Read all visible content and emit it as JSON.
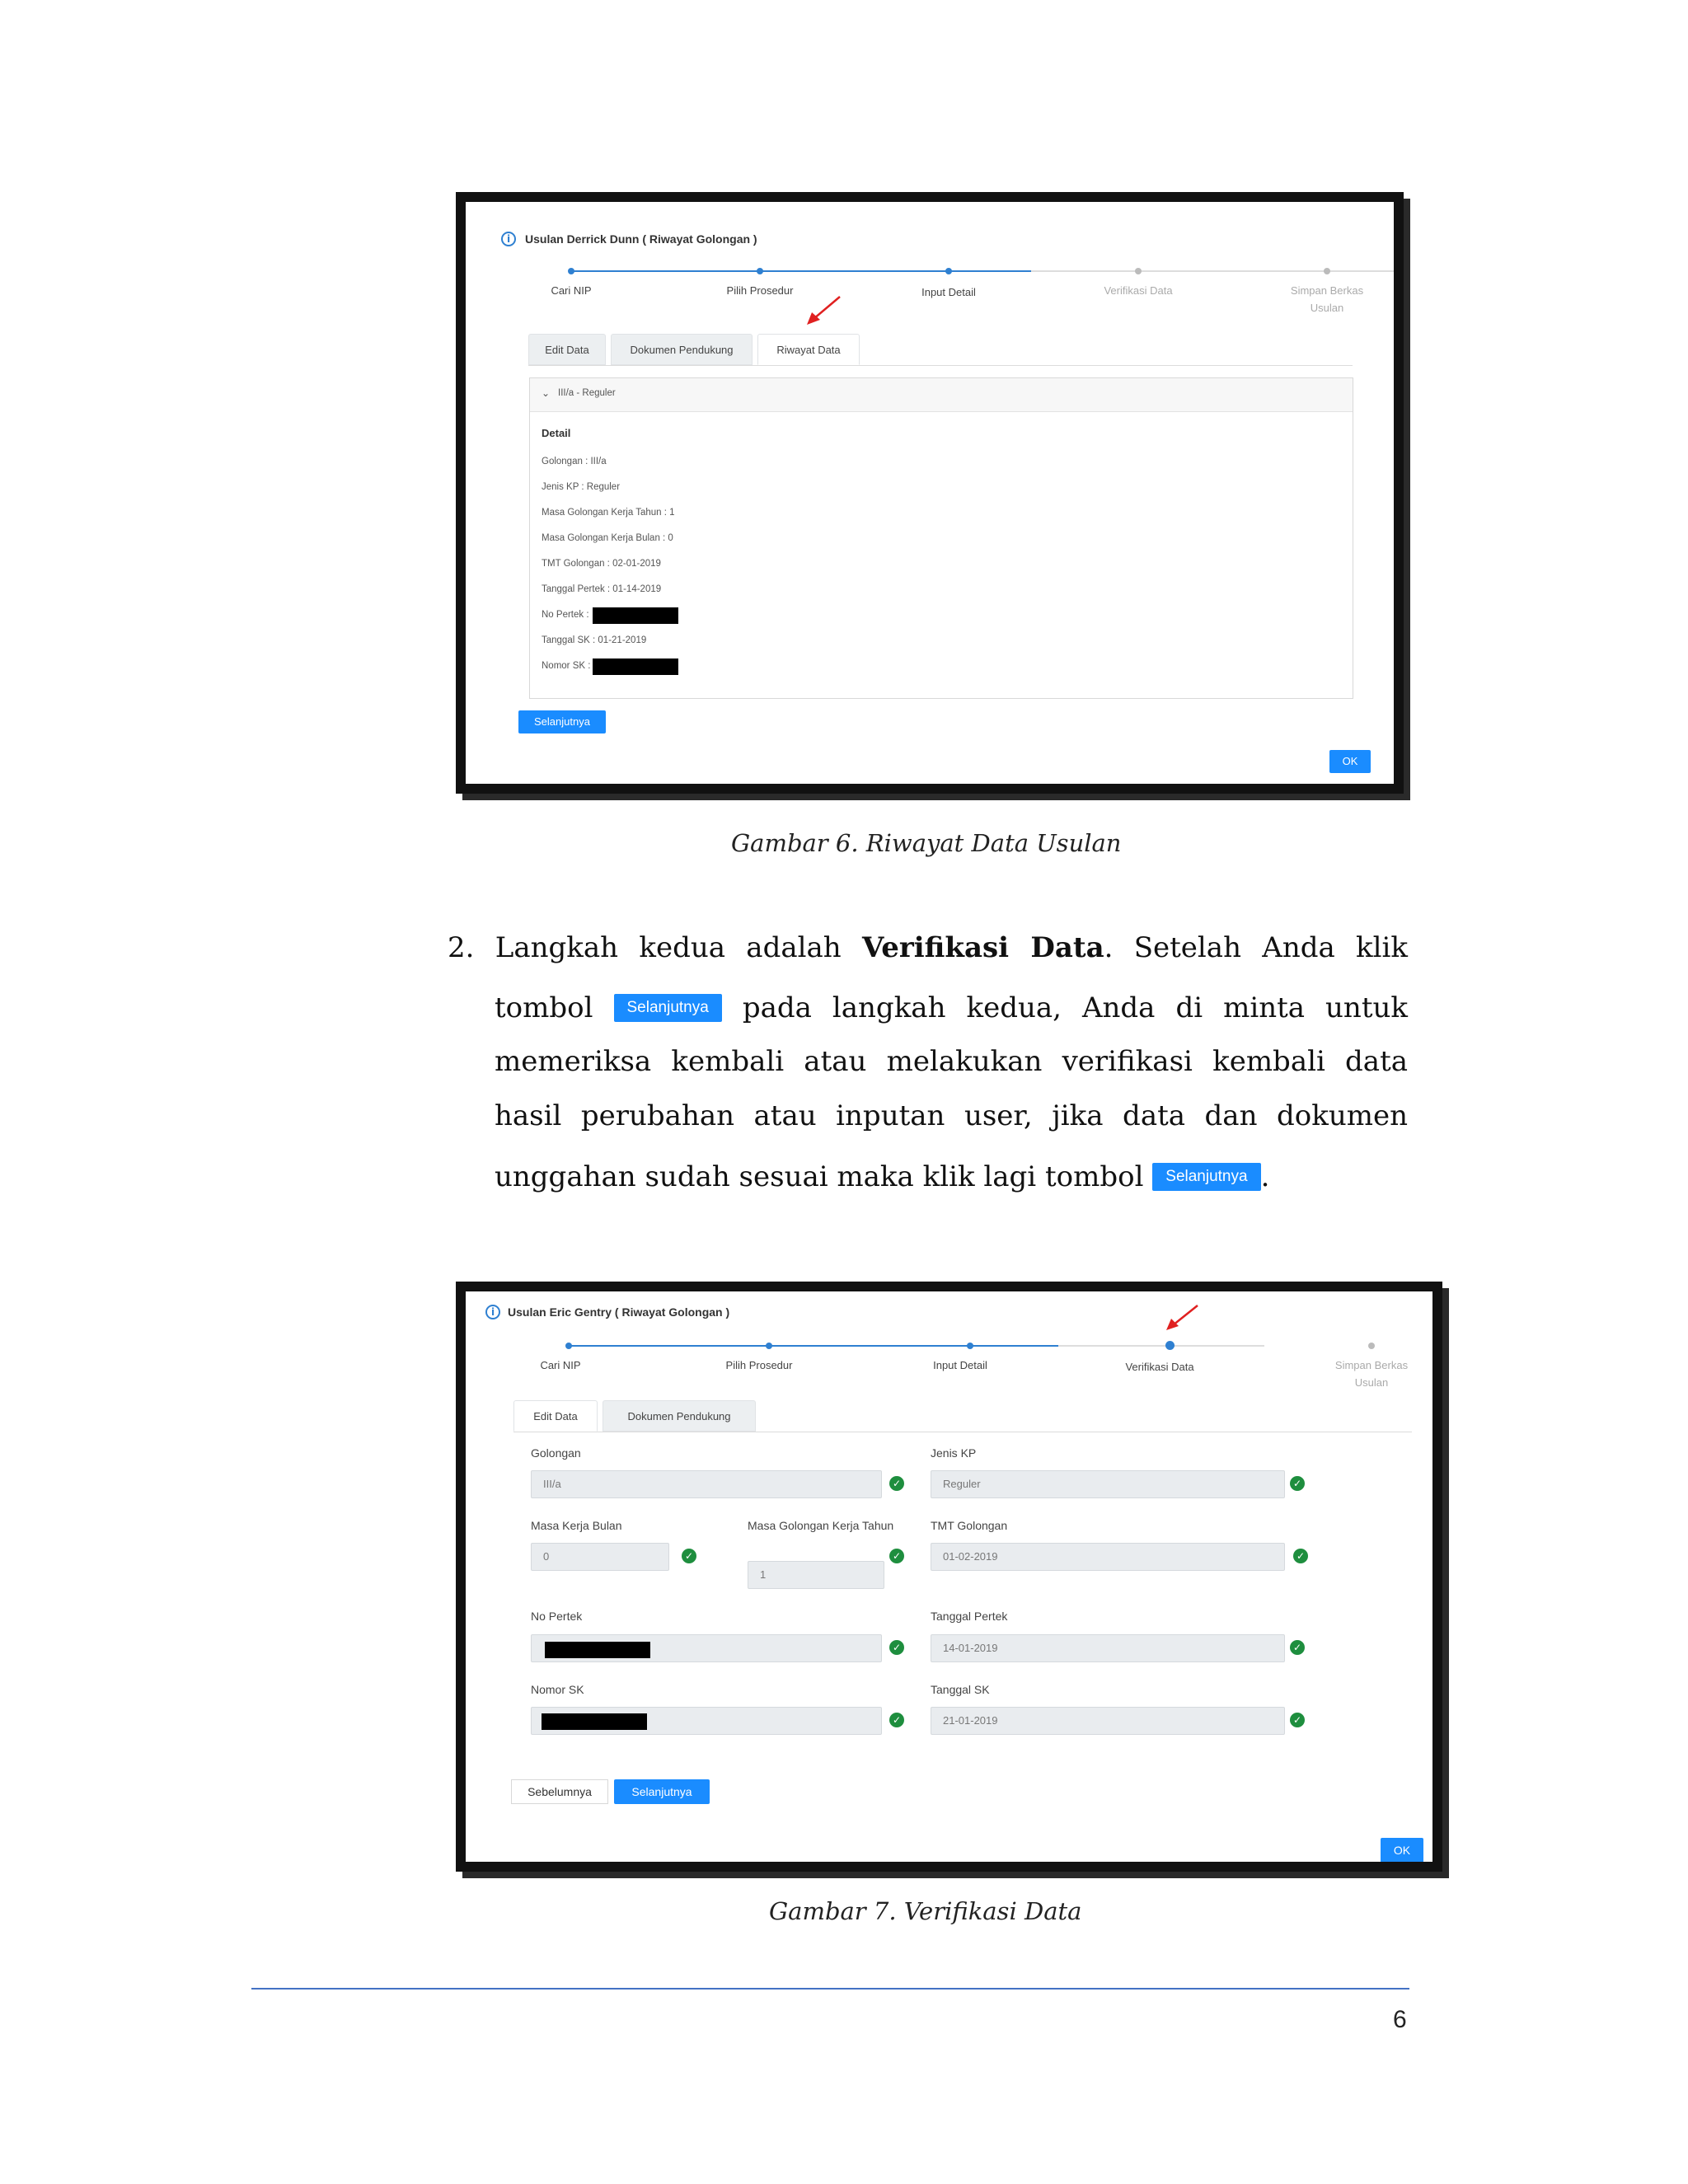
{
  "figure6": {
    "title": "Usulan Derrick Dunn ( Riwayat Golongan )",
    "steps": [
      "Cari NIP",
      "Pilih Prosedur",
      "Input Detail",
      "Verifikasi Data",
      "Simpan Berkas Usulan"
    ],
    "tabs": [
      "Edit Data",
      "Dokumen Pendukung",
      "Riwayat Data"
    ],
    "accordion_label": "III/a - Reguler",
    "detail_heading": "Detail",
    "details": [
      "Golongan : III/a",
      "Jenis KP : Reguler",
      "Masa Golongan Kerja Tahun : 1",
      "Masa Golongan Kerja Bulan : 0",
      "TMT Golongan : 02-01-2019",
      "Tanggal Pertek : 01-14-2019",
      "No Pertek :",
      "Tanggal SK : 01-21-2019",
      "Nomor SK :"
    ],
    "next_button": "Selanjutnya",
    "ok_button": "OK"
  },
  "caption6": "Gambar 6. Riwayat Data Usulan",
  "paragraph": {
    "number": "2.",
    "line1_a": "Langkah kedua adalah ",
    "line1_bold": "Verifikasi Data",
    "line1_b": ". Setelah Anda klik",
    "line2_a": "tombol",
    "inline_button": "Selanjutnya",
    "line2_b": "pada langkah kedua, Anda di minta untuk",
    "line3": "memeriksa kembali atau melakukan verifikasi kembali data",
    "line4": "hasil perubahan atau inputan user, jika data dan dokumen",
    "line5": "unggahan sudah sesuai maka klik lagi tombol",
    "line5_end": "."
  },
  "figure7": {
    "title": "Usulan Eric Gentry ( Riwayat Golongan )",
    "steps": [
      "Cari NIP",
      "Pilih Prosedur",
      "Input Detail",
      "Verifikasi Data",
      "Simpan Berkas Usulan"
    ],
    "tabs": [
      "Edit Data",
      "Dokumen Pendukung"
    ],
    "fields": {
      "golongan_label": "Golongan",
      "golongan_value": "III/a",
      "jenis_kp_label": "Jenis KP",
      "jenis_kp_value": "Reguler",
      "masa_bulan_label": "Masa Kerja Bulan",
      "masa_bulan_value": "0",
      "masa_tahun_label": "Masa Golongan Kerja Tahun",
      "masa_tahun_value": "1",
      "tmt_label": "TMT Golongan",
      "tmt_value": "01-02-2019",
      "no_pertek_label": "No Pertek",
      "tanggal_pertek_label": "Tanggal Pertek",
      "tanggal_pertek_value": "14-01-2019",
      "nomor_sk_label": "Nomor SK",
      "tanggal_sk_label": "Tanggal SK",
      "tanggal_sk_value": "21-01-2019"
    },
    "prev_button": "Sebelumnya",
    "next_button": "Selanjutnya",
    "ok_button": "OK"
  },
  "caption7": "Gambar 7. Verifikasi Data",
  "page_number": "6",
  "colors": {
    "accent": "#1a8cff",
    "step_active": "#2f80d1",
    "step_inactive": "#bbbbbb",
    "check": "#1e8e3e",
    "footer_rule": "#4472c4",
    "arrow": "#e02020"
  }
}
